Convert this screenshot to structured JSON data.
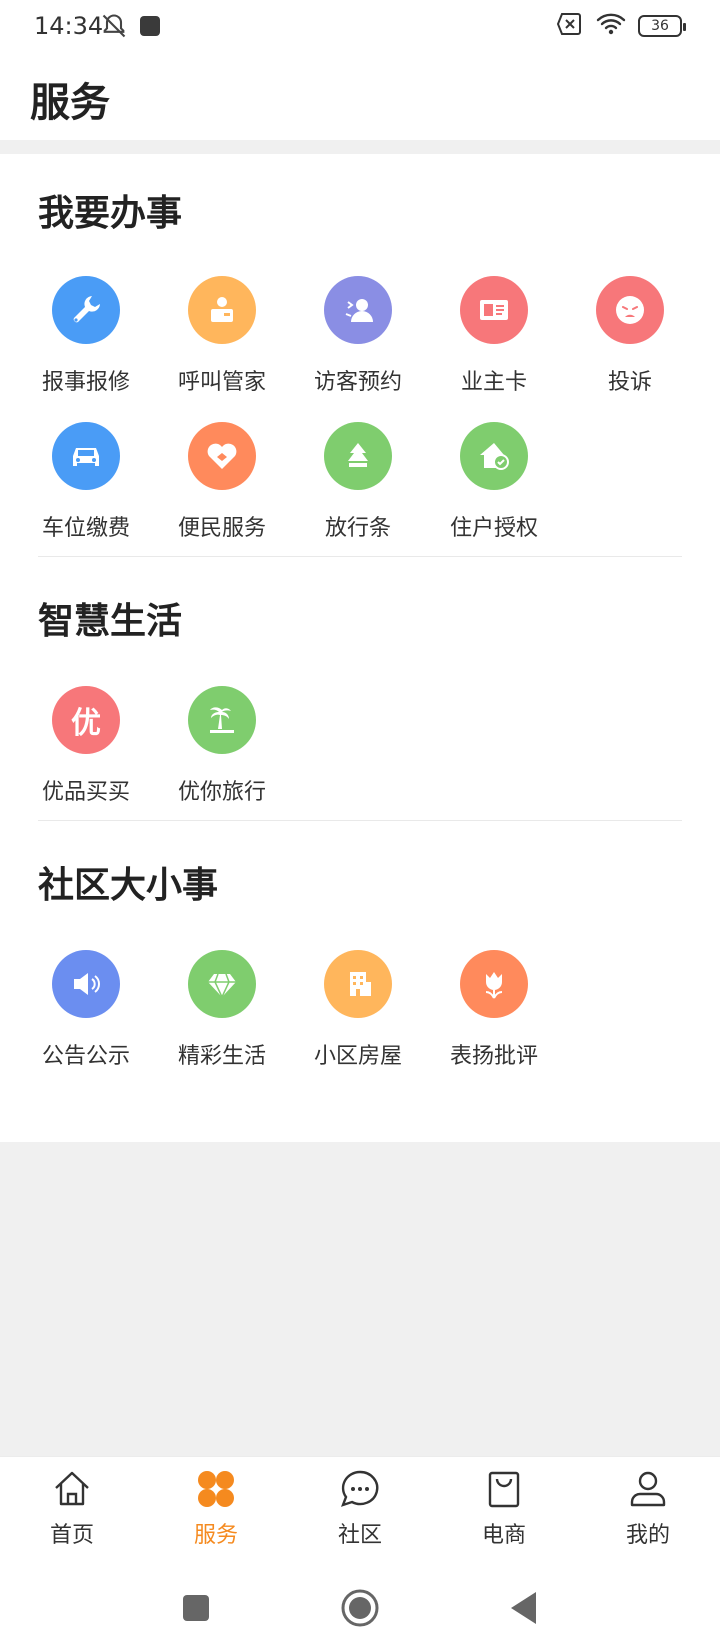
{
  "status": {
    "time": "14:34",
    "battery": "36"
  },
  "header": {
    "title": "服务"
  },
  "sections": [
    {
      "title": "我要办事",
      "items": [
        {
          "label": "报事报修",
          "icon": "wrench-icon",
          "color": "#4a9cf6"
        },
        {
          "label": "呼叫管家",
          "icon": "butler-icon",
          "color": "#ffb65c"
        },
        {
          "label": "访客预约",
          "icon": "visitor-icon",
          "color": "#8a8ee4"
        },
        {
          "label": "业主卡",
          "icon": "id-card-icon",
          "color": "#f7777a"
        },
        {
          "label": "投诉",
          "icon": "complaint-face-icon",
          "color": "#f7777a"
        },
        {
          "label": "车位缴费",
          "icon": "car-icon",
          "color": "#4a9cf6"
        },
        {
          "label": "便民服务",
          "icon": "heart-service-icon",
          "color": "#ff8a5c"
        },
        {
          "label": "放行条",
          "icon": "pass-tree-icon",
          "color": "#7fcd6e"
        },
        {
          "label": "住户授权",
          "icon": "home-check-icon",
          "color": "#7fcd6e"
        }
      ]
    },
    {
      "title": "智慧生活",
      "items": [
        {
          "label": "优品买买",
          "icon": "you-shop-icon",
          "glyph": "优",
          "color": "#f7777a"
        },
        {
          "label": "优你旅行",
          "icon": "palm-travel-icon",
          "color": "#7fcd6e"
        }
      ]
    },
    {
      "title": "社区大小事",
      "items": [
        {
          "label": "公告公示",
          "icon": "speaker-icon",
          "color": "#6b8ef0"
        },
        {
          "label": "精彩生活",
          "icon": "diamond-icon",
          "color": "#7fcd6e"
        },
        {
          "label": "小区房屋",
          "icon": "building-icon",
          "color": "#ffb65c"
        },
        {
          "label": "表扬批评",
          "icon": "tulip-icon",
          "color": "#ff8a5c"
        }
      ]
    }
  ],
  "bottom_nav": [
    {
      "label": "首页",
      "icon": "home-icon"
    },
    {
      "label": "服务",
      "icon": "services-grid-icon",
      "active": true
    },
    {
      "label": "社区",
      "icon": "chat-bubble-icon"
    },
    {
      "label": "电商",
      "icon": "shopping-bag-icon"
    },
    {
      "label": "我的",
      "icon": "profile-icon"
    }
  ],
  "colors": {
    "accent": "#f58a1f",
    "background": "#f0f0f0"
  }
}
